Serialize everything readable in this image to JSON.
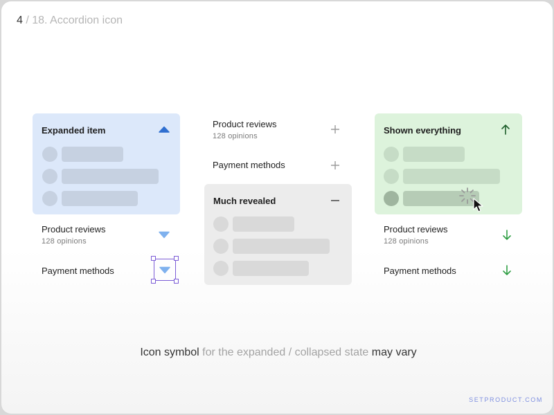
{
  "header": {
    "page_current": "4",
    "page_rest": " / 18. Accordion icon"
  },
  "column_left": {
    "expanded_title": "Expanded item",
    "rows": [
      {
        "title": "Product reviews",
        "subtitle": "128 opinions"
      },
      {
        "title": "Payment methods"
      }
    ]
  },
  "column_middle": {
    "rows": [
      {
        "title": "Product reviews",
        "subtitle": "128 opinions"
      },
      {
        "title": "Payment methods"
      }
    ],
    "expanded_title": "Much revealed"
  },
  "column_right": {
    "expanded_title": "Shown everything",
    "rows": [
      {
        "title": "Product reviews",
        "subtitle": "128 opinions"
      },
      {
        "title": "Payment methods"
      }
    ]
  },
  "caption": {
    "part1": "Icon symbol",
    "part2": " for the expanded / collapsed state ",
    "part3": "may vary"
  },
  "brand": "SETPRODUCT.COM",
  "icons": {
    "left_expanded": "triangle-up-icon",
    "left_collapsed": "triangle-down-icon",
    "middle_collapsed": "plus-icon",
    "middle_expanded": "minus-icon",
    "right_expanded": "arrow-up-icon",
    "right_collapsed": "arrow-down-icon"
  },
  "colors": {
    "blue_panel": "#dce8fa",
    "blue_icon": "#2f6fd0",
    "light_blue_icon": "#7fb1ee",
    "gray_panel": "#ececec",
    "green_panel": "#ddf3dc",
    "green_icon": "#2f9e44",
    "selection": "#7b5bd6",
    "brand": "#7e8fe0"
  }
}
